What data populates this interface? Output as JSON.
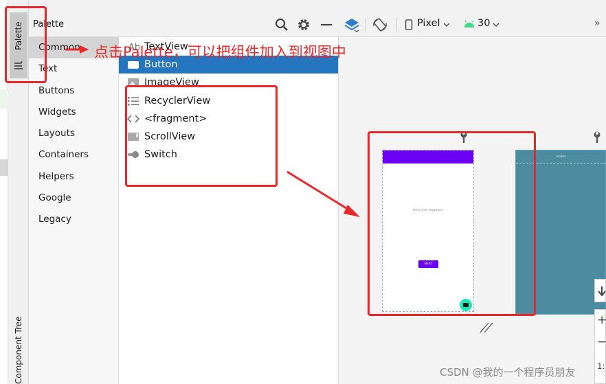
{
  "tool_strip": {
    "palette_tab": "Palette",
    "component_tree_tab": "Component Tree"
  },
  "palette": {
    "title": "Palette",
    "categories": [
      {
        "label": "Common",
        "selected": true
      },
      {
        "label": "Text"
      },
      {
        "label": "Buttons"
      },
      {
        "label": "Widgets"
      },
      {
        "label": "Layouts"
      },
      {
        "label": "Containers"
      },
      {
        "label": "Helpers"
      },
      {
        "label": "Google"
      },
      {
        "label": "Legacy"
      }
    ],
    "widgets": [
      {
        "label": "TextView",
        "icon": "textview-icon"
      },
      {
        "label": "Button",
        "icon": "button-icon",
        "selected": true
      },
      {
        "label": "ImageView",
        "icon": "imageview-icon"
      },
      {
        "label": "RecyclerView",
        "icon": "list-icon"
      },
      {
        "label": "<fragment>",
        "icon": "code-brackets-icon"
      },
      {
        "label": "ScrollView",
        "icon": "scrollview-icon"
      },
      {
        "label": "Switch",
        "icon": "switch-icon"
      }
    ]
  },
  "toolbar": {
    "device": "Pixel",
    "api_level": "30",
    "more": "»"
  },
  "design": {
    "phone_text": "Hello first fragment",
    "next_button": "NEXT",
    "blueprint_label": "toolbar"
  },
  "zoom": {
    "plus": "+",
    "minus": "−",
    "ratio": "1:"
  },
  "annotation": {
    "text": "点击Palette，可以把组件加入到视图中",
    "color": "#e8282a"
  },
  "watermark": "CSDN @我的一个程序员朋友",
  "colors": {
    "selection": "#2675bf",
    "phone_primary": "#6a00f4",
    "fab": "#1de9b6",
    "blueprint": "#4d8ca0",
    "android_green": "#3ddc84"
  }
}
